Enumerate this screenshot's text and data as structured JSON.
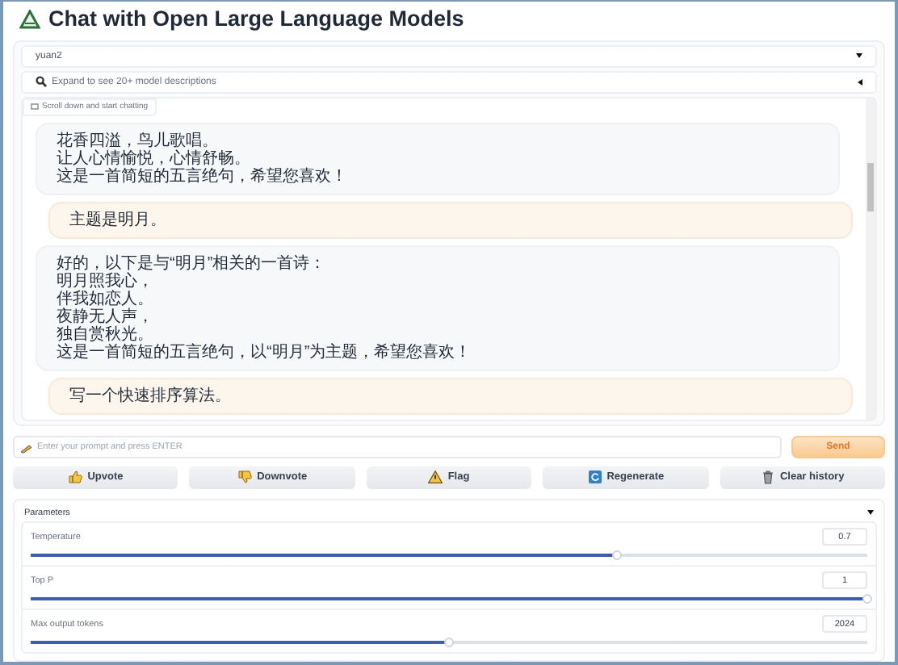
{
  "header": {
    "title": "Chat with Open Large Language Models"
  },
  "model_select": {
    "value": "yuan2"
  },
  "model_descriptions": {
    "label": "Expand to see 20+ model descriptions",
    "expanded": false
  },
  "chatbot": {
    "label": "Scroll down and start chatting",
    "messages": [
      {
        "kind": "bot",
        "lines": [
          "花香四溢，鸟儿歌唱。",
          "让人心情愉悦，心情舒畅。",
          "这是一首简短的五言绝句，希望您喜欢！"
        ]
      },
      {
        "kind": "user",
        "lines": [
          "主题是明月。"
        ]
      },
      {
        "kind": "bot",
        "lines": [
          "好的，以下是与“明月”相关的一首诗：",
          "明月照我心，",
          "伴我如恋人。",
          "夜静无人声，",
          "独自赏秋光。",
          "这是一首简短的五言绝句，以“明月”为主题，希望您喜欢！"
        ]
      },
      {
        "kind": "user",
        "lines": [
          "写一个快速排序算法。"
        ]
      }
    ]
  },
  "prompt": {
    "placeholder": "Enter your prompt and press ENTER"
  },
  "send_button": "Send",
  "actions": [
    {
      "kind": "upvote",
      "label": "Upvote"
    },
    {
      "kind": "downvote",
      "label": "Downvote"
    },
    {
      "kind": "flag",
      "label": "Flag"
    },
    {
      "kind": "regenerate",
      "label": "Regenerate"
    },
    {
      "kind": "clear",
      "label": "Clear history"
    }
  ],
  "parameters": {
    "label": "Parameters",
    "expanded": true,
    "sliders": [
      {
        "label": "Temperature",
        "value": "0.7",
        "level": 0.7
      },
      {
        "label": "Top P",
        "value": "1",
        "level": 1
      },
      {
        "label": "Max output tokens",
        "value": "2024",
        "level": 0.5
      }
    ]
  }
}
